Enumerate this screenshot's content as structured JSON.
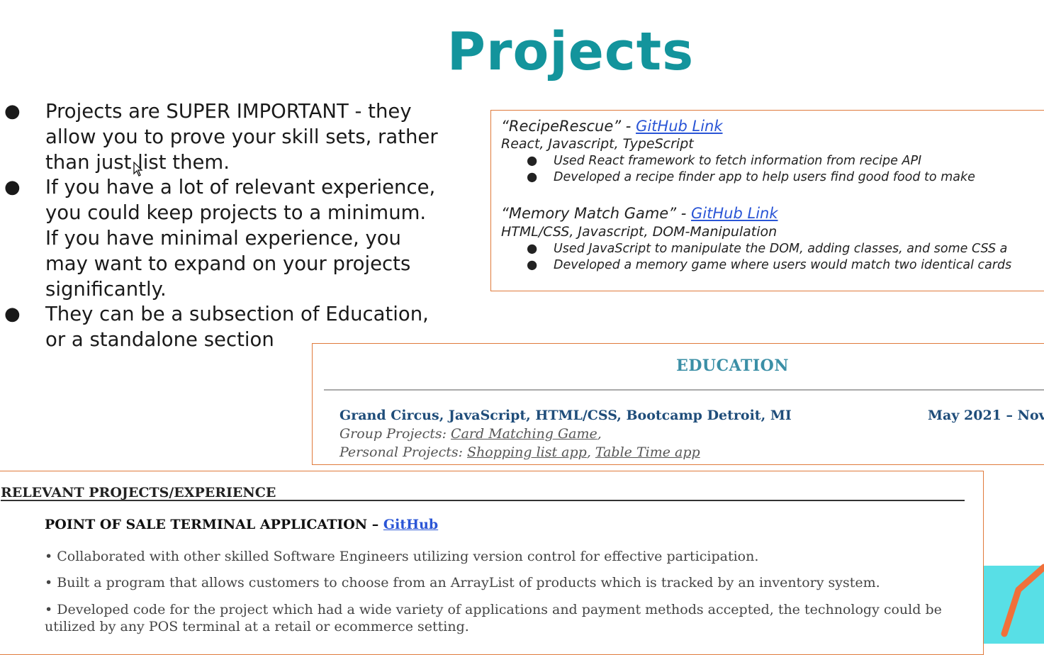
{
  "slide": {
    "title": "Projects",
    "bullets": [
      {
        "lines": [
          "Projects are SUPER IMPORTANT - they",
          "allow you to prove your skill sets, rather",
          "than just list them."
        ]
      },
      {
        "lines": [
          "If you have a lot of relevant experience,",
          "you could keep projects to a minimum.",
          "If you have minimal experience, you",
          "may want to expand on your projects",
          "significantly."
        ]
      },
      {
        "lines": [
          "They can be a subsection of Education,",
          "or a standalone section"
        ]
      }
    ]
  },
  "card1": {
    "projects": [
      {
        "name": "“RecipeRescue” - ",
        "link": "GitHub Link",
        "tech": "React, Javascript, TypeScript",
        "points": [
          "Used React framework to fetch information from recipe API",
          "Developed a recipe finder app to help users find good food to make"
        ]
      },
      {
        "name": "“Memory Match Game” - ",
        "link": "GitHub Link",
        "tech": "HTML/CSS, Javascript, DOM-Manipulation",
        "points": [
          "Used JavaScript to manipulate the DOM, adding classes,  and some CSS a",
          "Developed a memory game where users would match two identical cards"
        ]
      }
    ]
  },
  "card2": {
    "heading": "EDUCATION",
    "school": "Grand Circus, JavaScript, HTML/CSS, Bootcamp Detroit, MI",
    "date": "May 2021 –  Nov",
    "group_label": "Group Projects: ",
    "group_link": "Card Matching Game",
    "group_trail": ",",
    "personal_label": "Personal Projects: ",
    "personal_link1": "Shopping list app",
    "personal_sep": ", ",
    "personal_link2": "Table Time app "
  },
  "card3": {
    "heading": "RELEVANT PROJECTS/EXPERIENCE",
    "project_title": "POINT OF SALE TERMINAL APPLICATION – ",
    "project_link": "GitHub",
    "points": [
      "• Collaborated with other skilled Software Engineers utilizing version control for effective participation.",
      "• Built a program that allows customers to choose from an ArrayList of products which is tracked by an inventory system.",
      "• Developed code for the project which had a wide variety of applications and payment methods accepted, the technology could be utilized by any POS terminal at a retail or ecommerce setting."
    ]
  },
  "colors": {
    "title": "#13949c",
    "card_border": "#e07a3c",
    "link": "#2a55d6",
    "education_heading": "#3b8fa6",
    "education_school": "#1f4d7a",
    "decor_teal": "#58dfe6",
    "decor_orange": "#f0703a"
  }
}
